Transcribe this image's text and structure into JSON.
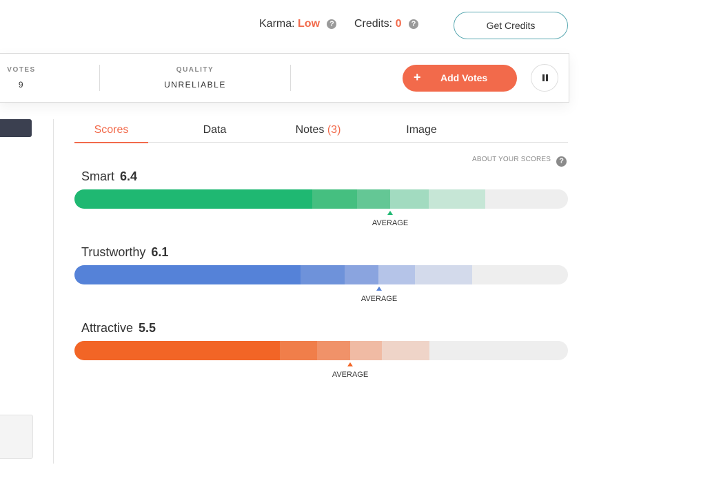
{
  "header": {
    "karma_label": "Karma:",
    "karma_value": "Low",
    "credits_label": "Credits:",
    "credits_value": "0",
    "get_credits_label": "Get Credits"
  },
  "stats": {
    "votes_label": "VOTES",
    "votes_value": "9",
    "quality_label": "QUALITY",
    "quality_value": "UNRELIABLE",
    "add_votes_label": "Add Votes",
    "add_votes_icon": "+"
  },
  "tabs": [
    {
      "label": "Scores",
      "active": true
    },
    {
      "label": "Data"
    },
    {
      "label": "Notes",
      "count": "(3)"
    },
    {
      "label": "Image"
    }
  ],
  "about_scores_label": "ABOUT YOUR SCORES",
  "scores": [
    {
      "name": "Smart",
      "value": "6.4",
      "average_label": "AVERAGE",
      "color": "#1fb872",
      "segments": [
        "#1fb872",
        "#45bf80",
        "#64c795",
        "#a2dbc0",
        "#c6e6d6"
      ],
      "average_fraction": 0.64
    },
    {
      "name": "Trustworthy",
      "value": "6.1",
      "average_label": "AVERAGE",
      "color": "#5582d8",
      "segments": [
        "#5582d8",
        "#6e92da",
        "#8aa4df",
        "#b5c4e8",
        "#d3daeb"
      ],
      "average_fraction": 0.617
    },
    {
      "name": "Attractive",
      "value": "5.5",
      "average_label": "AVERAGE",
      "color": "#f26526",
      "segments": [
        "#f26526",
        "#f07e4a",
        "#f09269",
        "#f0bba4",
        "#efd4c8"
      ],
      "average_fraction": 0.559
    }
  ],
  "colors": {
    "accent": "#f26a4b",
    "dark_panel": "#3b4050",
    "track": "#eeeeee"
  }
}
